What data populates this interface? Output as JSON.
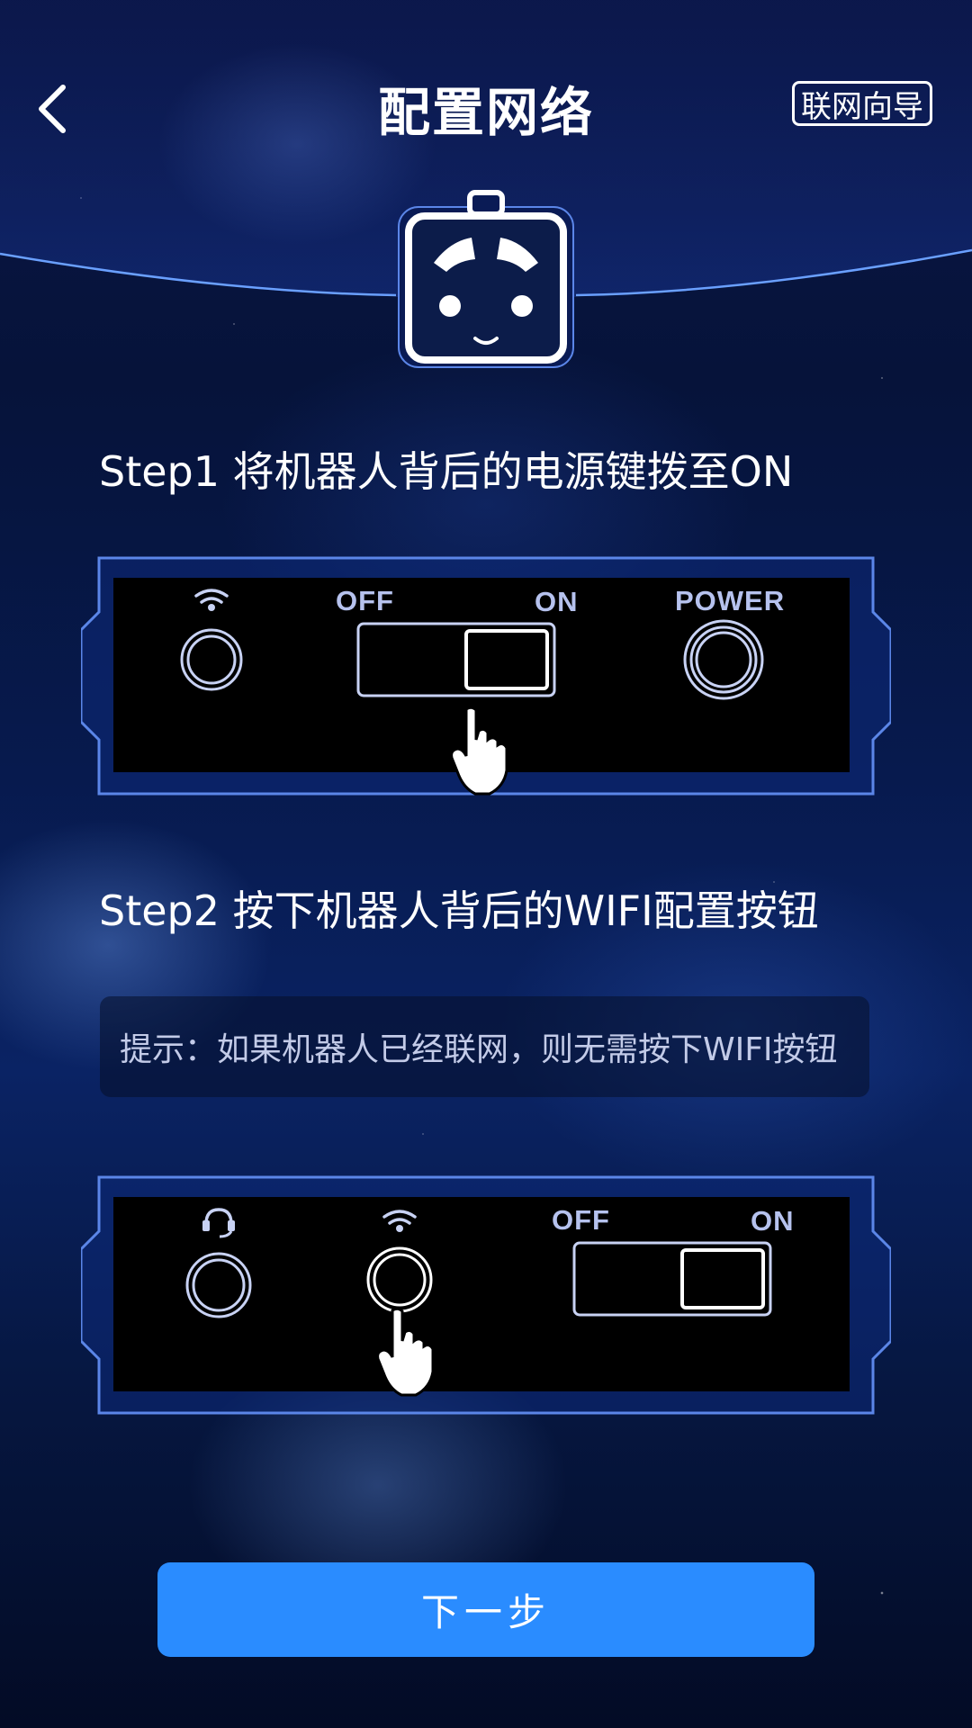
{
  "header": {
    "back_icon": "chevron-left-icon",
    "title": "配置网络",
    "guide_label": "联网向导"
  },
  "robot": {
    "icon": "robot-face-icon"
  },
  "step1": {
    "title": "Step1 将机器人背后的电源键拨至ON",
    "panel": {
      "off_label": "OFF",
      "on_label": "ON",
      "power_label": "POWER",
      "wifi_icon": "wifi-icon",
      "hand_icon": "hand-pointer-icon",
      "switch_state": "on"
    }
  },
  "step2": {
    "title": "Step2 按下机器人背后的WIFI配置按钮",
    "tip": "提示：如果机器人已经联网，则无需按下WIFI按钮",
    "panel": {
      "off_label": "OFF",
      "on_label": "ON",
      "headset_icon": "headset-icon",
      "wifi_icon": "wifi-icon",
      "hand_icon": "hand-pointer-icon",
      "switch_state": "on"
    }
  },
  "footer": {
    "next_label": "下一步"
  },
  "colors": {
    "accent": "#2a8cff",
    "panel_border": "#5b86e8",
    "label": "#b6c2ee"
  }
}
